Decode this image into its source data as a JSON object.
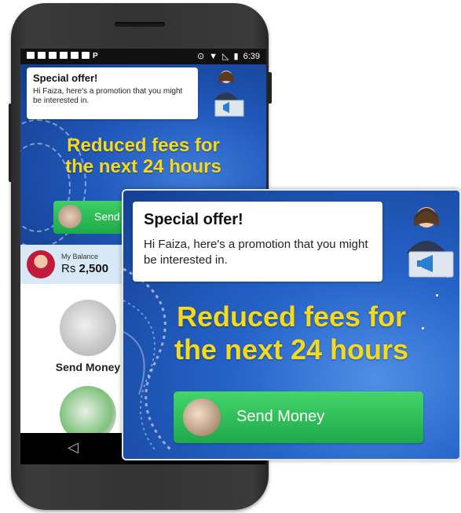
{
  "status_bar": {
    "time": "6:39"
  },
  "promo": {
    "title": "Special offer!",
    "message": "Hi Faiza, here's a promotion that you might be interested in.",
    "headline_line1": "Reduced fees for",
    "headline_line2": "the next 24 hours",
    "cta_label": "Send Money",
    "cta_label_small": "Send"
  },
  "balance": {
    "label": "My Balance",
    "currency": "Rs",
    "amount": "2,500"
  },
  "tiles": [
    {
      "label": "Send Money"
    }
  ],
  "nav": {
    "back_icon": "back-triangle-icon"
  },
  "colors": {
    "headline": "#f6d91a",
    "cta": "#2bbd55",
    "background": "#1f56b8",
    "balance_bar": "#d7e8f6"
  }
}
